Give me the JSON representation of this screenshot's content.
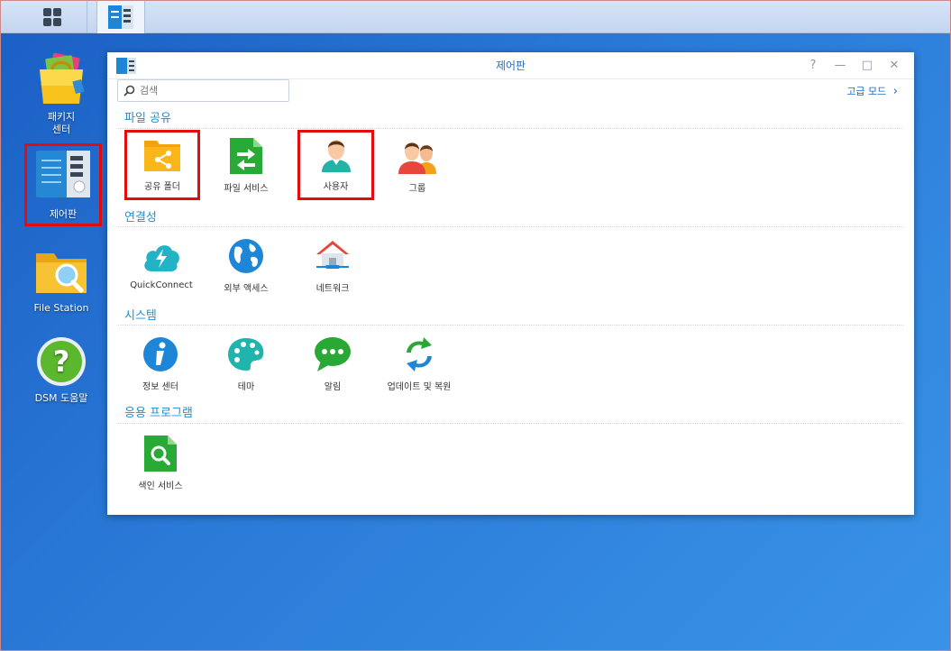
{
  "taskbar": {
    "main_menu_icon": "apps-grid-icon",
    "active_app_icon": "control-panel-icon"
  },
  "desktop": {
    "icons": [
      {
        "label_line1": "패키지",
        "label_line2": "센터",
        "icon": "package-center-icon"
      },
      {
        "label": "제어판",
        "icon": "control-panel-icon"
      },
      {
        "label": "File Station",
        "icon": "file-station-icon"
      },
      {
        "label": "DSM 도움말",
        "icon": "help-icon"
      }
    ]
  },
  "window": {
    "title": "제어판",
    "search_placeholder": "검색",
    "advanced_mode": "고급 모드",
    "sections": [
      {
        "title": "파일 공유",
        "items": [
          {
            "label": "공유 폴더",
            "icon": "shared-folder-icon"
          },
          {
            "label": "파일 서비스",
            "icon": "file-services-icon"
          },
          {
            "label": "사용자",
            "icon": "user-icon"
          },
          {
            "label": "그룹",
            "icon": "group-icon"
          }
        ]
      },
      {
        "title": "연결성",
        "items": [
          {
            "label": "QuickConnect",
            "icon": "quickconnect-icon"
          },
          {
            "label": "외부 액세스",
            "icon": "external-access-icon"
          },
          {
            "label": "네트워크",
            "icon": "network-icon"
          }
        ]
      },
      {
        "title": "시스템",
        "items": [
          {
            "label": "정보 센터",
            "icon": "info-center-icon"
          },
          {
            "label": "테마",
            "icon": "theme-icon"
          },
          {
            "label": "알림",
            "icon": "notification-icon"
          },
          {
            "label": "업데이트 및 복원",
            "icon": "update-restore-icon"
          }
        ]
      },
      {
        "title": "응용 프로그램",
        "items": [
          {
            "label": "색인 서비스",
            "icon": "indexing-service-icon"
          }
        ]
      }
    ]
  },
  "colors": {
    "highlight": "#e30c0c",
    "section_title": "#1f8fcf",
    "link": "#1a6bc5"
  }
}
